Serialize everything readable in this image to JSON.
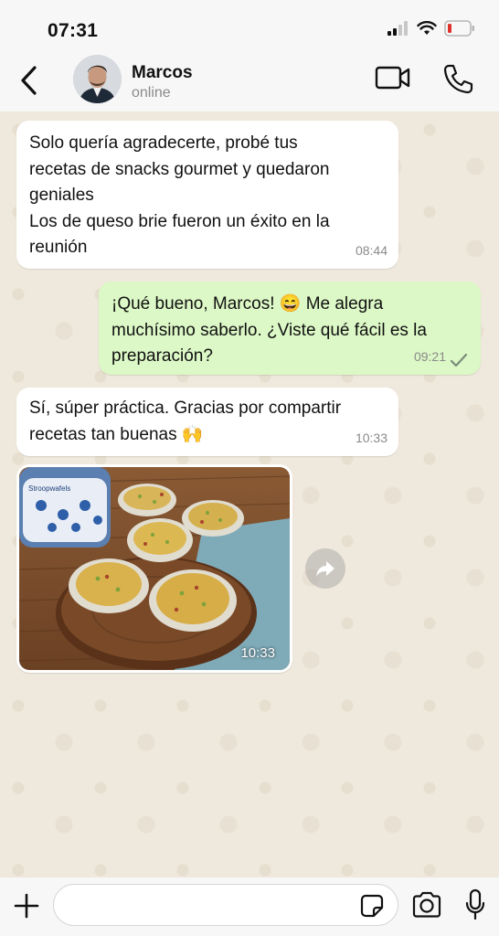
{
  "status_bar": {
    "time": "07:31"
  },
  "contact": {
    "name": "Marcos",
    "status": "online"
  },
  "messages": [
    {
      "direction": "in",
      "lines": [
        "Solo quería agradecerte, probé tus",
        "recetas de snacks gourmet y quedaron",
        "geniales",
        "Los de queso brie fueron un éxito en la",
        "reunión"
      ],
      "time": "08:44"
    },
    {
      "direction": "out",
      "lines": [
        "¡Qué bueno, Marcos! 😄  Me alegra",
        "muchísimo saberlo. ¿Viste qué fácil es la",
        "preparación?"
      ],
      "time": "09:21",
      "status": "read"
    },
    {
      "direction": "in",
      "lines": [
        "Sí, súper práctica. Gracias por compartir",
        "recetas tan buenas 🙌"
      ],
      "time": "10:33"
    }
  ],
  "image_message": {
    "time": "10:33",
    "jar_label": "Stroopwafels"
  },
  "input": {
    "placeholder": "",
    "value": ""
  },
  "icons": {
    "back": "chevron-left-icon",
    "video": "video-camera-icon",
    "call": "phone-icon",
    "plus": "plus-icon",
    "sticker": "sticker-icon",
    "camera": "camera-icon",
    "mic": "microphone-icon",
    "forward": "forward-arrow-icon",
    "read": "check-icon"
  },
  "colors": {
    "incoming_bubble": "#ffffff",
    "outgoing_bubble": "#dcf8c6",
    "chat_background": "#efe8dc",
    "battery_low": "#e0302b"
  }
}
